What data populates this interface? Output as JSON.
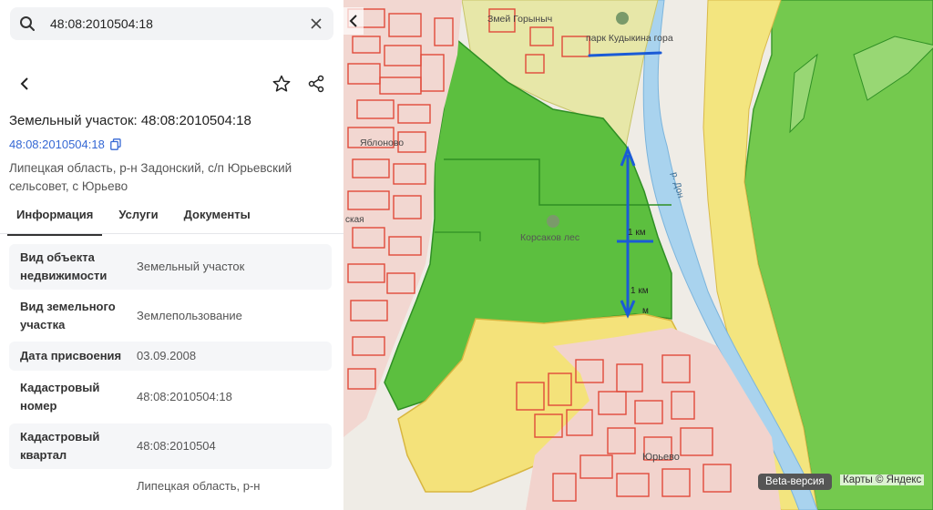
{
  "search": {
    "value": "48:08:2010504:18"
  },
  "header": {
    "title": "Земельный участок: 48:08:2010504:18",
    "cadastral_link": "48:08:2010504:18",
    "address": "Липецкая область, р-н Задонский, с/п Юрьевский сельсовет, с Юрьево"
  },
  "tabs": [
    {
      "label": "Информация",
      "active": true
    },
    {
      "label": "Услуги",
      "active": false
    },
    {
      "label": "Документы",
      "active": false
    }
  ],
  "info": [
    {
      "key": "Вид объекта недвижимости",
      "value": "Земельный участок"
    },
    {
      "key": "Вид земельного участка",
      "value": "Землепользование"
    },
    {
      "key": "Дата присвоения",
      "value": "03.09.2008"
    },
    {
      "key": "Кадастровый номер",
      "value": "48:08:2010504:18"
    },
    {
      "key": "Кадастровый квартал",
      "value": "48:08:2010504"
    },
    {
      "key": "",
      "value": "Липецкая область, р-н"
    }
  ],
  "map": {
    "labels": {
      "zmey": "Змей Горыныч",
      "park": "парк Кудыкина гора",
      "forest": "Корсаков лес",
      "river": "р. Дон",
      "km1": "1 км",
      "km2": "1 км",
      "m": "м",
      "town": "Юрьево",
      "village": "Яблоново",
      "kaya": "ская"
    },
    "badge": "Beta-версия",
    "credit": "Карты © Яндекс"
  },
  "colors": {
    "accent": "#3568d4",
    "forest_green": "#5cbf3f",
    "yellow_zone": "#f4e27a",
    "red_outline": "#e04a3a",
    "river": "#a9d3ee",
    "route_blue": "#1a5bd6"
  }
}
